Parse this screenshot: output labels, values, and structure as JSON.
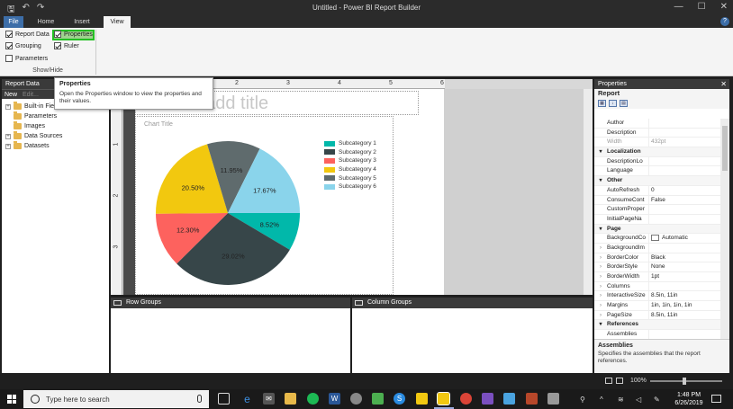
{
  "window": {
    "title": "Untitled - Power BI Report Builder",
    "minimize": "—",
    "maximize": "☐",
    "close": "✕"
  },
  "tabs": {
    "file": "File",
    "home": "Home",
    "insert": "Insert",
    "view": "View",
    "help": "?"
  },
  "ribbon": {
    "report_data": "Report Data",
    "grouping": "Grouping",
    "parameters": "Parameters",
    "properties": "Properties",
    "ruler": "Ruler",
    "group_label": "Show/Hide",
    "checked": {
      "report_data": true,
      "grouping": true,
      "parameters": false,
      "properties": true,
      "ruler": true
    }
  },
  "tooltip": {
    "title": "Properties",
    "description": "Open the Properties window to view the properties and their values."
  },
  "report_data": {
    "header": "Report Data",
    "new": "New",
    "edit": "Edit...",
    "items": [
      {
        "label": "Built-in Fie",
        "expandable": true
      },
      {
        "label": "Parameters",
        "expandable": false
      },
      {
        "label": "Images",
        "expandable": false
      },
      {
        "label": "Data Sources",
        "expandable": true
      },
      {
        "label": "Datasets",
        "expandable": true
      }
    ]
  },
  "ruler": {
    "h_marks": [
      "2",
      "3",
      "4",
      "5",
      "6"
    ],
    "v_marks": [
      "1",
      "2",
      "3"
    ]
  },
  "report": {
    "title_placeholder": "Click to add title",
    "chart_title": "Chart Title"
  },
  "chart_data": {
    "type": "pie",
    "title": "Chart Title",
    "legend_position": "right",
    "series": [
      {
        "name": "Subcategory 1",
        "value": 8.52,
        "label": "8.52%",
        "color": "#01b8aa"
      },
      {
        "name": "Subcategory 2",
        "value": 29.02,
        "label": "29.02%",
        "color": "#374649"
      },
      {
        "name": "Subcategory 3",
        "value": 12.3,
        "label": "12.30%",
        "color": "#fd625e"
      },
      {
        "name": "Subcategory 4",
        "value": 20.5,
        "label": "20.50%",
        "color": "#f2c80f"
      },
      {
        "name": "Subcategory 5",
        "value": 11.95,
        "label": "11.95%",
        "color": "#5f6b6d"
      },
      {
        "name": "Subcategory 6",
        "value": 17.67,
        "label": "17.67%",
        "color": "#8ad4eb"
      }
    ]
  },
  "groups": {
    "row": "Row Groups",
    "column": "Column Groups"
  },
  "properties": {
    "header": "Properties",
    "close": "✕",
    "object": "Report",
    "rows": [
      {
        "kind": "prop",
        "name": "Author",
        "value": ""
      },
      {
        "kind": "prop",
        "name": "Description",
        "value": ""
      },
      {
        "kind": "prop",
        "name": "Width",
        "value": "432pt",
        "dimmed": true
      },
      {
        "kind": "cat",
        "name": "Localization"
      },
      {
        "kind": "prop",
        "name": "DescriptionLo",
        "value": ""
      },
      {
        "kind": "prop",
        "name": "Language",
        "value": ""
      },
      {
        "kind": "cat",
        "name": "Other"
      },
      {
        "kind": "prop",
        "name": "AutoRefresh",
        "value": "0"
      },
      {
        "kind": "prop",
        "name": "ConsumeCont",
        "value": "False"
      },
      {
        "kind": "prop",
        "name": "CustomProper",
        "value": ""
      },
      {
        "kind": "prop",
        "name": "InitialPageNa",
        "value": ""
      },
      {
        "kind": "cat",
        "name": "Page"
      },
      {
        "kind": "prop",
        "name": "BackgroundCo",
        "value": "Automatic",
        "swatch": true
      },
      {
        "kind": "prop",
        "name": "BackgroundIm",
        "value": "",
        "expand": true
      },
      {
        "kind": "prop",
        "name": "BorderColor",
        "value": "Black",
        "expand": true
      },
      {
        "kind": "prop",
        "name": "BorderStyle",
        "value": "None",
        "expand": true
      },
      {
        "kind": "prop",
        "name": "BorderWidth",
        "value": "1pt",
        "expand": true
      },
      {
        "kind": "prop",
        "name": "Columns",
        "value": "",
        "expand": true
      },
      {
        "kind": "prop",
        "name": "InteractiveSize",
        "value": "8.5in, 11in",
        "expand": true
      },
      {
        "kind": "prop",
        "name": "Margins",
        "value": "1in, 1in, 1in, 1in",
        "expand": true
      },
      {
        "kind": "prop",
        "name": "PageSize",
        "value": "8.5in, 11in",
        "expand": true
      },
      {
        "kind": "cat",
        "name": "References"
      },
      {
        "kind": "prop",
        "name": "Assemblies",
        "value": ""
      }
    ],
    "desc_title": "Assemblies",
    "desc_text": "Specifies the assemblies that the report references."
  },
  "status": {
    "zoom": "100%"
  },
  "taskbar": {
    "search_placeholder": "Type here to search",
    "time": "1:48 PM",
    "date": "6/26/2019"
  }
}
